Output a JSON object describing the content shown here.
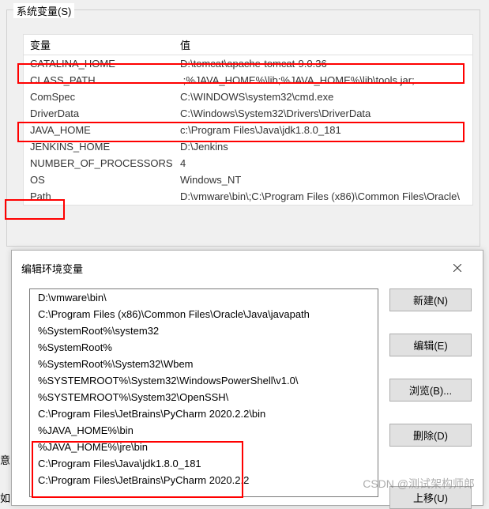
{
  "sysvars": {
    "group_label": "系统变量(S)",
    "headers": {
      "var": "变量",
      "val": "值"
    },
    "rows": [
      {
        "var": "CATALINA_HOME",
        "val": "D:\\tomcat\\apache-tomcat-9.0.36"
      },
      {
        "var": "CLASS_PATH",
        "val": ".;%JAVA_HOME%\\lib;%JAVA_HOME%\\lib\\tools.jar;"
      },
      {
        "var": "ComSpec",
        "val": "C:\\WINDOWS\\system32\\cmd.exe"
      },
      {
        "var": "DriverData",
        "val": "C:\\Windows\\System32\\Drivers\\DriverData"
      },
      {
        "var": "JAVA_HOME",
        "val": "c:\\Program Files\\Java\\jdk1.8.0_181"
      },
      {
        "var": "JENKINS_HOME",
        "val": "D:\\Jenkins"
      },
      {
        "var": "NUMBER_OF_PROCESSORS",
        "val": "4"
      },
      {
        "var": "OS",
        "val": "Windows_NT"
      },
      {
        "var": "Path",
        "val": "D:\\vmware\\bin\\;C:\\Program Files (x86)\\Common Files\\Oracle\\"
      }
    ]
  },
  "dialog": {
    "title": "编辑环境变量",
    "list": [
      "D:\\vmware\\bin\\",
      "C:\\Program Files (x86)\\Common Files\\Oracle\\Java\\javapath",
      "%SystemRoot%\\system32",
      "%SystemRoot%",
      "%SystemRoot%\\System32\\Wbem",
      "%SYSTEMROOT%\\System32\\WindowsPowerShell\\v1.0\\",
      "%SYSTEMROOT%\\System32\\OpenSSH\\",
      "C:\\Program Files\\JetBrains\\PyCharm 2020.2.2\\bin",
      "%JAVA_HOME%\\bin",
      "%JAVA_HOME%\\jre\\bin",
      "C:\\Program Files\\Java\\jdk1.8.0_181",
      "C:\\Program Files\\JetBrains\\PyCharm 2020.2.2"
    ],
    "buttons": {
      "new": "新建(N)",
      "edit": "编辑(E)",
      "browse": "浏览(B)...",
      "delete": "删除(D)",
      "move_up": "上移(U)"
    }
  },
  "fragments": {
    "yi": "意",
    "ru": "如"
  },
  "watermark": "CSDN @测试架构师郎"
}
